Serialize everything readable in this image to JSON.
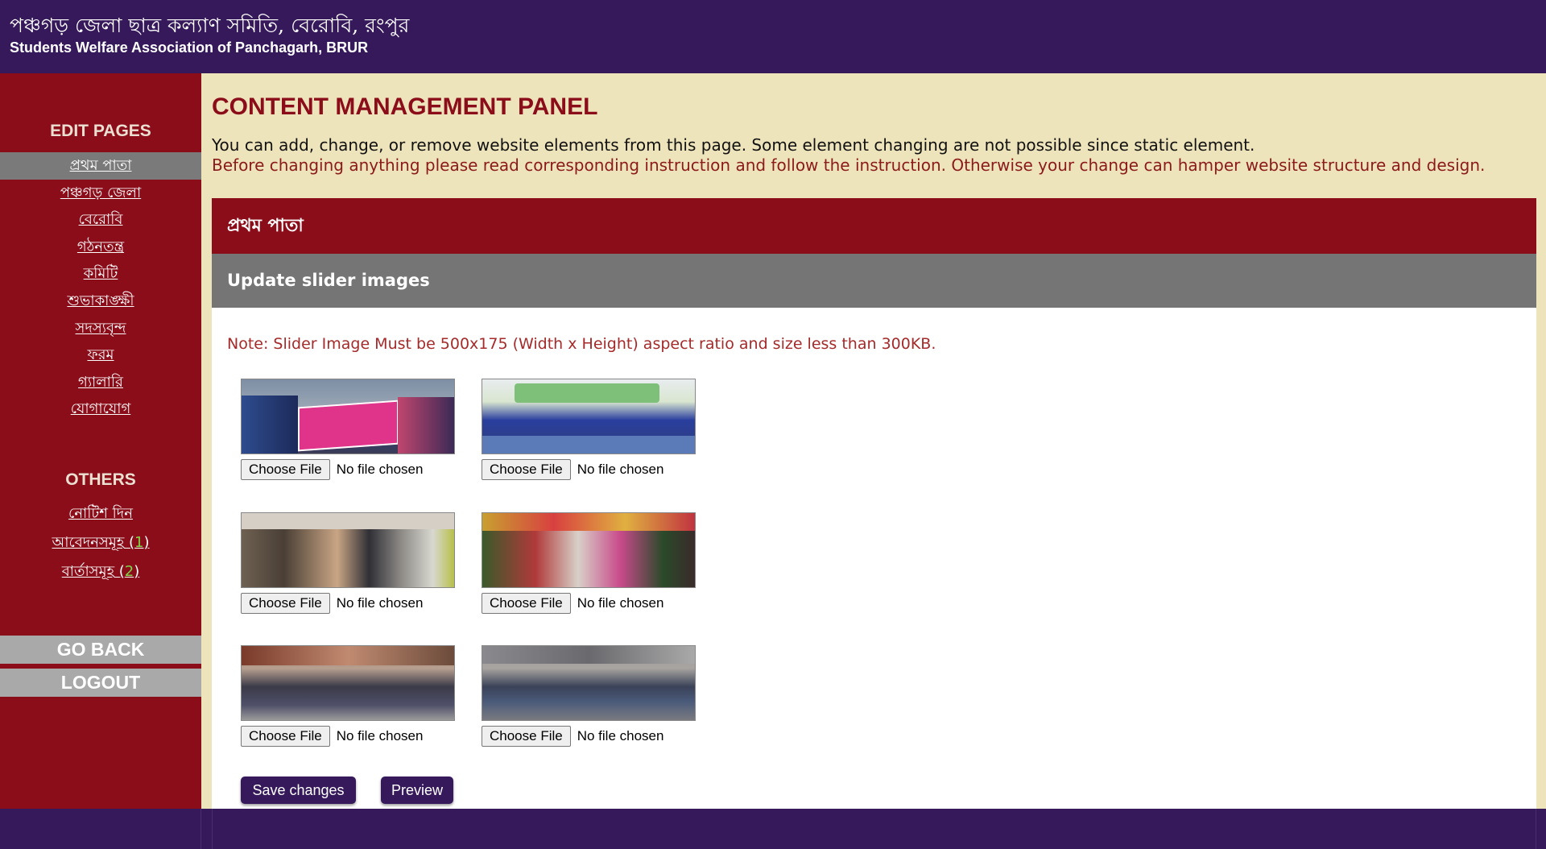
{
  "header": {
    "title_bn": "পঞ্চগড় জেলা ছাত্র কল্যাণ সমিতি, বেরোবি, রংপুর",
    "title_en": "Students Welfare Association of Panchagarh, BRUR"
  },
  "sidebar": {
    "edit_heading": "EDIT PAGES",
    "edit_items": [
      {
        "label": "প্রথম পাতা",
        "active": true
      },
      {
        "label": "পঞ্চগড় জেলা"
      },
      {
        "label": "বেরোবি"
      },
      {
        "label": "গঠনতন্ত্র"
      },
      {
        "label": "কমিটি"
      },
      {
        "label": "শুভাকাঙ্ক্ষী"
      },
      {
        "label": "সদস্যবৃন্দ"
      },
      {
        "label": "ফরম"
      },
      {
        "label": "গ্যালারি"
      },
      {
        "label": "যোগাযোগ"
      }
    ],
    "others_heading": "OTHERS",
    "others_items": [
      {
        "label": "নোটিশ দিন"
      },
      {
        "label": "আবেদনসমূহ",
        "count": "1"
      },
      {
        "label": "বার্তাসমূহ",
        "count": "2"
      }
    ],
    "go_back": "GO BACK",
    "logout": "LOGOUT"
  },
  "main": {
    "title": "CONTENT MANAGEMENT PANEL",
    "desc1": "You can add, change, or remove website elements from this page. Some element changing are not possible since static element.",
    "desc2": "Before changing anything please read corresponding instruction and follow the instruction. Otherwise your change can hamper website structure and design.",
    "section_title": "প্রথম পাতা",
    "subsection_title": "Update slider images",
    "note": "Note: Slider Image Must be 500x175 (Width x Height) aspect ratio and size less than 300KB.",
    "file_button": "Choose File",
    "file_status": "No file chosen",
    "save_button": "Save changes",
    "preview_button": "Preview"
  },
  "colors": {
    "header_bg": "#36195b",
    "sidebar_bg": "#8b0d1a",
    "main_bg": "#eee4bc",
    "accent_red": "#8b0d1a"
  }
}
